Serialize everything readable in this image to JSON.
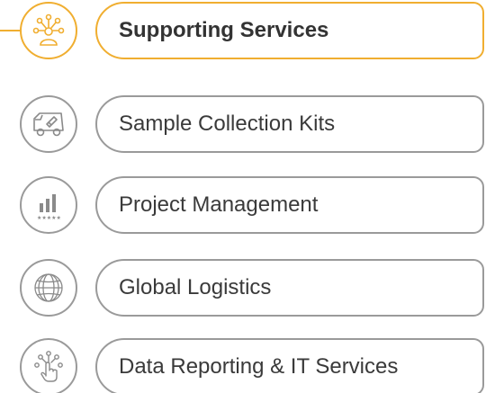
{
  "accent_color": "#F0AE30",
  "border_color": "#9a9a9a",
  "items": [
    {
      "label": "Supporting Services",
      "icon": "network-person-icon",
      "active": true
    },
    {
      "label": "Sample Collection Kits",
      "icon": "delivery-van-icon",
      "active": false
    },
    {
      "label": "Project Management",
      "icon": "bar-chart-rating-icon",
      "active": false
    },
    {
      "label": "Global Logistics",
      "icon": "globe-icon",
      "active": false
    },
    {
      "label": "Data Reporting & IT Services",
      "icon": "touch-network-icon",
      "active": false
    }
  ]
}
